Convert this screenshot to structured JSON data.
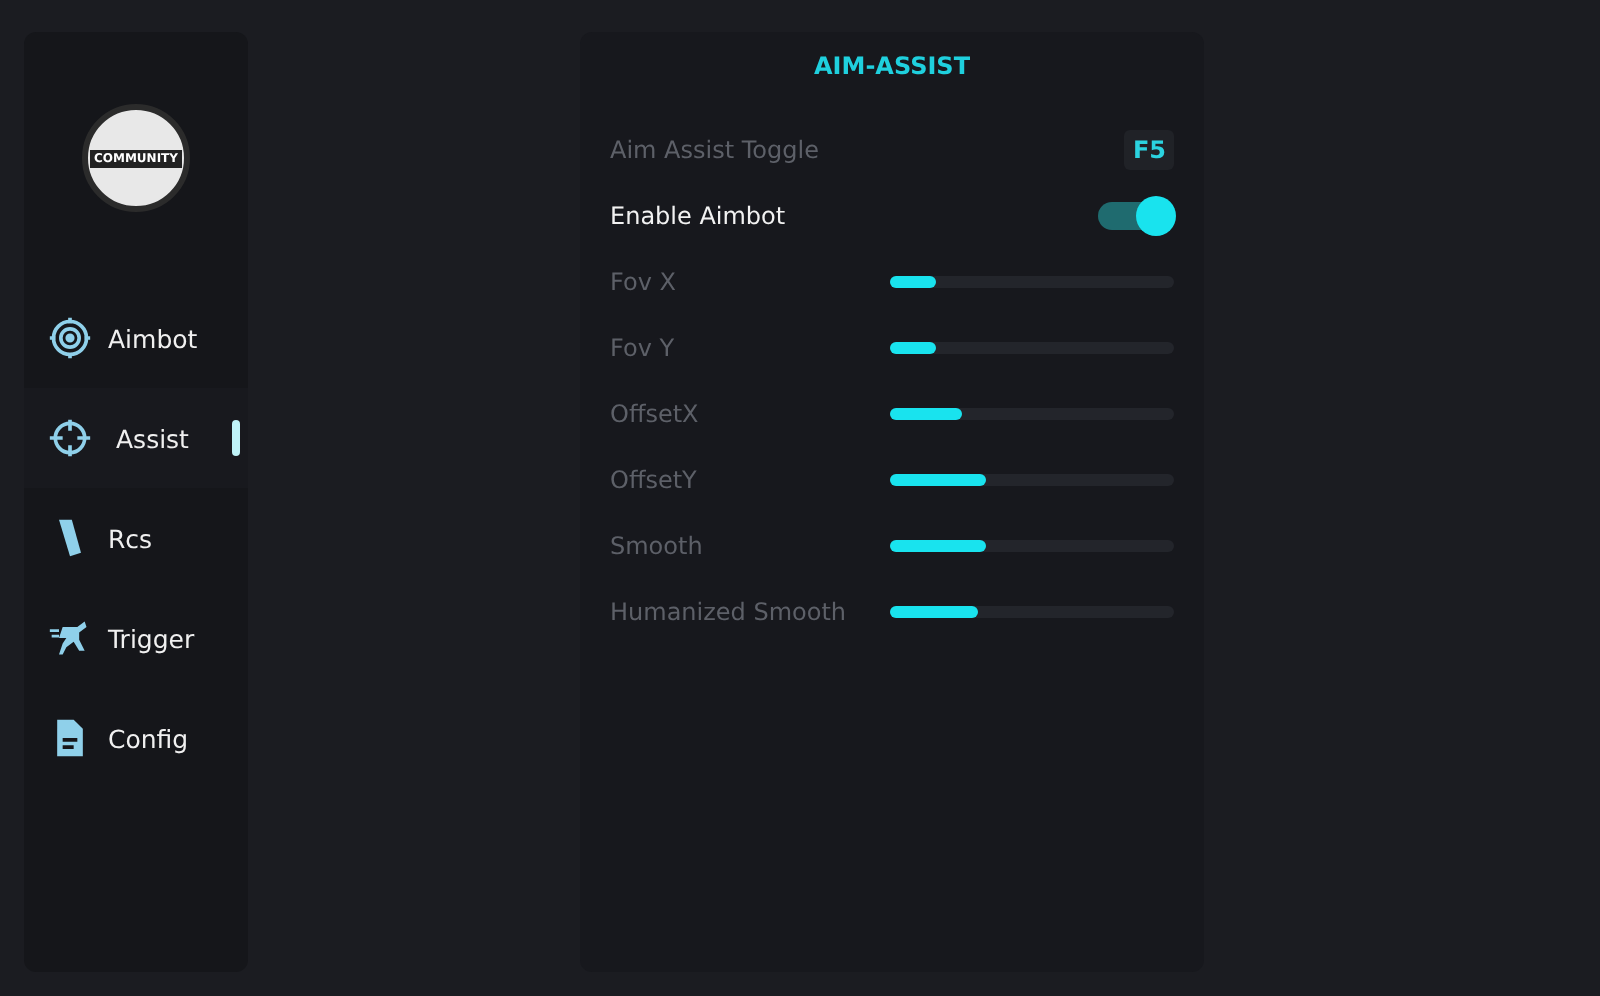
{
  "logo": {
    "text": "COMMUNITY"
  },
  "nav": [
    {
      "label": "Aimbot",
      "kind": "target",
      "selected": false
    },
    {
      "label": "Assist",
      "kind": "crosshair",
      "selected": true
    },
    {
      "label": "Rcs",
      "kind": "magazine",
      "selected": false
    },
    {
      "label": "Trigger",
      "kind": "runner",
      "selected": false
    },
    {
      "label": "Config",
      "kind": "file",
      "selected": false
    }
  ],
  "panel": {
    "title": "AIM-ASSIST",
    "rows": [
      {
        "kind": "key",
        "label": "Aim Assist Toggle",
        "value": "F5"
      },
      {
        "kind": "toggle",
        "label": "Enable Aimbot",
        "on": true
      },
      {
        "kind": "slider",
        "label": "Fov X",
        "level": 0.16
      },
      {
        "kind": "slider",
        "label": "Fov Y",
        "level": 0.16
      },
      {
        "kind": "slider",
        "label": "OffsetX",
        "level": 0.25
      },
      {
        "kind": "slider",
        "label": "OffsetY",
        "level": 0.34
      },
      {
        "kind": "slider",
        "label": "Smooth",
        "level": 0.34
      },
      {
        "kind": "slider",
        "label": "Humanized Smooth",
        "level": 0.31
      }
    ]
  }
}
